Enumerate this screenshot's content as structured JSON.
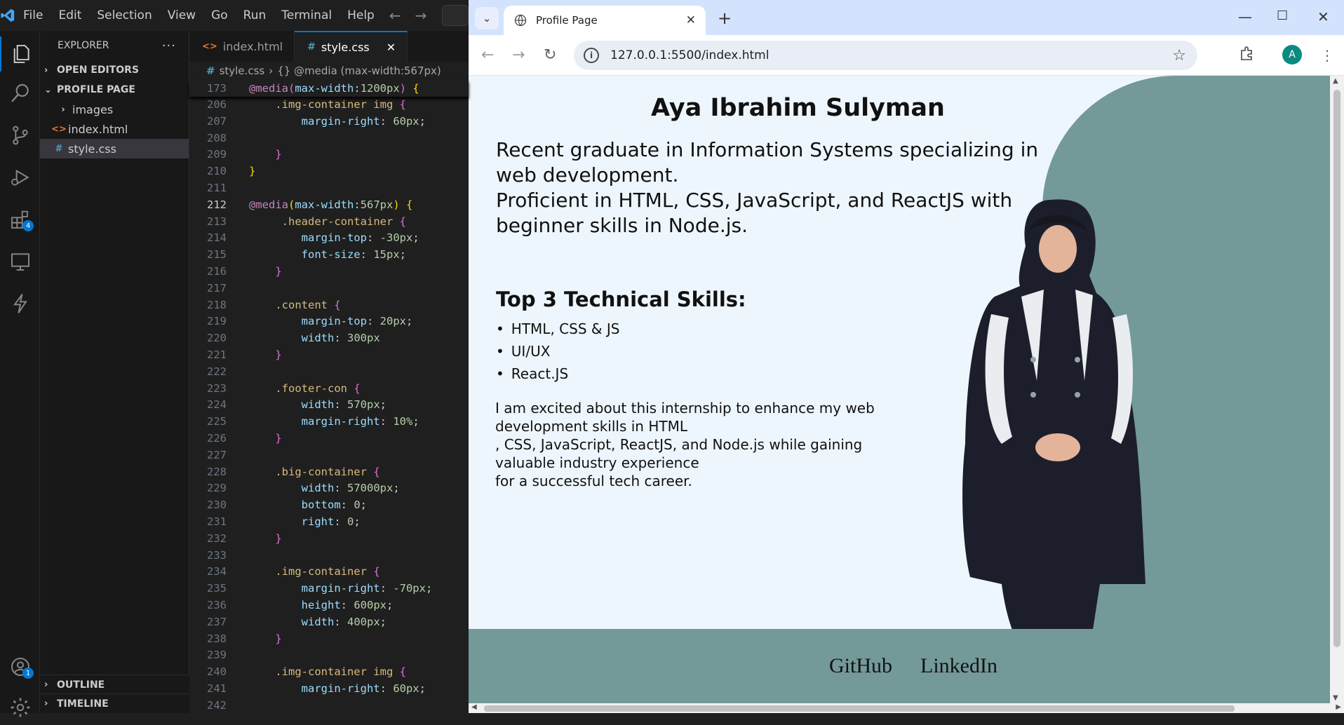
{
  "vscode": {
    "menu": [
      "File",
      "Edit",
      "Selection",
      "View",
      "Go",
      "Run",
      "Terminal",
      "Help"
    ],
    "extensions_badge": "4",
    "accounts_badge": "1",
    "explorer": {
      "title": "EXPLORER",
      "open_editors": "OPEN EDITORS",
      "folder": "PROFILE PAGE",
      "items": [
        {
          "name": "images",
          "kind": "folder"
        },
        {
          "name": "index.html",
          "kind": "html"
        },
        {
          "name": "style.css",
          "kind": "css"
        }
      ],
      "outline": "OUTLINE",
      "timeline": "TIMELINE"
    },
    "tabs": [
      {
        "label": "index.html",
        "active": false
      },
      {
        "label": "style.css",
        "active": true
      }
    ],
    "breadcrumb": {
      "file": "style.css",
      "symbol": "{} @media (max-width:567px)"
    },
    "sticky_line": {
      "number": "173",
      "text": "@media(max-width:1200px) {"
    },
    "current_line": "212"
  },
  "browser": {
    "tab_title": "Profile Page",
    "url": "127.0.0.1:5500/index.html",
    "avatar_letter": "A"
  },
  "page": {
    "name": "Aya Ibrahim Sulyman",
    "intro_line1": "Recent graduate in Information Systems specializing in web development.",
    "intro_line2": "Proficient in HTML, CSS, JavaScript, and ReactJS with beginner skills in Node.js.",
    "skills_title": "Top 3 Technical Skills:",
    "skills": [
      "HTML, CSS & JS",
      "UI/UX",
      "React.JS"
    ],
    "excited_line1": "I am excited about this internship to enhance my web development skills in HTML",
    "excited_line2": ", CSS, JavaScript, ReactJS, and Node.js while gaining valuable industry experience",
    "excited_line3": "for a successful tech career.",
    "links": [
      "GitHub",
      "LinkedIn"
    ]
  },
  "colors": {
    "accent": "#0078d4",
    "teal": "#739a99",
    "page_bg": "#eef6fd"
  }
}
